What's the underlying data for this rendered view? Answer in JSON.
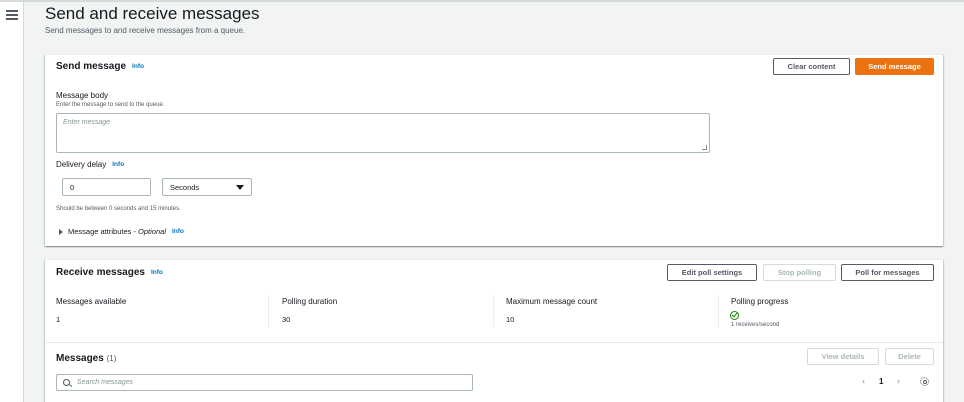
{
  "page": {
    "title": "Send and receive messages",
    "subtitle": "Send messages to and receive messages from a queue."
  },
  "send": {
    "title": "Send message",
    "info": "Info",
    "clear_label": "Clear content",
    "send_label": "Send message",
    "body_label": "Message body",
    "body_hint": "Enter the message to send to the queue.",
    "body_placeholder": "Enter message",
    "delay_label": "Delivery delay",
    "delay_info": "Info",
    "delay_value": "0",
    "delay_unit": "Seconds",
    "delay_hint": "Should be between 0 seconds and 15 minutes.",
    "attributes_label": "Message attributes - ",
    "attributes_optional": "Optional",
    "attributes_info": "Info"
  },
  "receive": {
    "title": "Receive messages",
    "info": "Info",
    "edit_label": "Edit poll settings",
    "stop_label": "Stop polling",
    "poll_label": "Poll for messages",
    "stats": [
      {
        "label": "Messages available",
        "value": "1"
      },
      {
        "label": "Polling duration",
        "value": "30"
      },
      {
        "label": "Maximum message count",
        "value": "10"
      },
      {
        "label": "Polling progress",
        "value": "1 receives/second"
      }
    ]
  },
  "messages": {
    "title": "Messages",
    "count": "(1)",
    "view_label": "View details",
    "delete_label": "Delete",
    "search_placeholder": "Search messages",
    "page": "1"
  },
  "colors": {
    "primary": "#ec7211",
    "link": "#0073bb",
    "success": "#1d8102"
  }
}
